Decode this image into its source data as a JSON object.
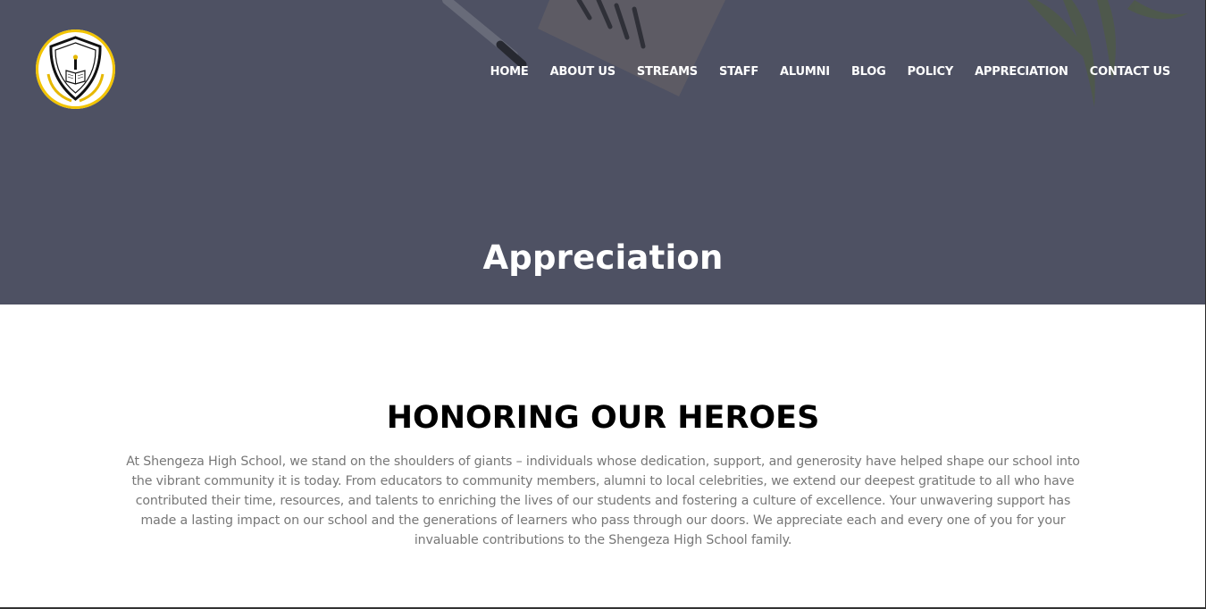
{
  "header": {
    "logo_alt": "Shengeza High School crest",
    "nav": [
      {
        "label": "HOME"
      },
      {
        "label": "ABOUT US"
      },
      {
        "label": "STREAMS"
      },
      {
        "label": "STAFF"
      },
      {
        "label": "ALUMNI"
      },
      {
        "label": "BLOG"
      },
      {
        "label": "POLICY"
      },
      {
        "label": "APPRECIATION"
      },
      {
        "label": "CONTACT US"
      }
    ]
  },
  "hero": {
    "title": "Appreciation"
  },
  "main": {
    "heading": "HONORING OUR HEROES",
    "body": "At Shengeza High School, we stand on the shoulders of giants – individuals whose dedication, support, and generosity have helped shape our school into the vibrant community it is today. From educators to community members, alumni to local celebrities, we extend our deepest gratitude to all who have contributed their time, resources, and talents to enriching the lives of our students and fostering a culture of excellence. Your unwavering support has made a lasting impact on our school and the generations of learners who pass through our doors. We appreciate each and every one of you for your invaluable contributions to the Shengeza High School family."
  },
  "colors": {
    "hero_overlay": "#4e5163",
    "logo_ring": "#f2c400",
    "heading": "#000000",
    "body_text": "#777777"
  }
}
